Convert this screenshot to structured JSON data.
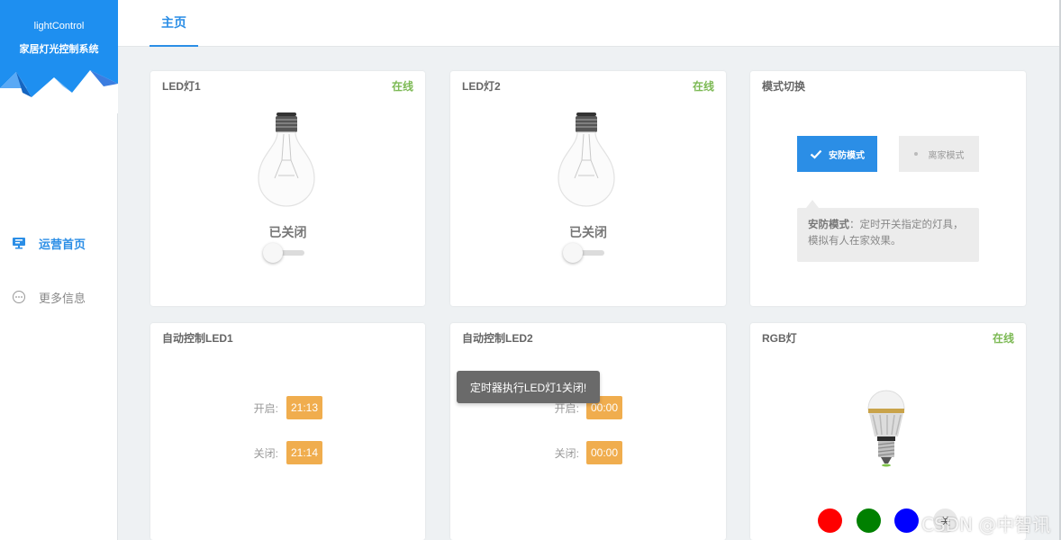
{
  "app": {
    "name": "lightControl",
    "subtitle": "家居灯光控制系统"
  },
  "sidebar": {
    "items": [
      {
        "label": "运营首页",
        "icon": "monitor-icon",
        "active": true
      },
      {
        "label": "更多信息",
        "icon": "more-circle-icon",
        "active": false
      }
    ]
  },
  "tabs": [
    {
      "label": "主页",
      "active": true
    }
  ],
  "cards": {
    "led1": {
      "title": "LED灯1",
      "status": "在线",
      "state": "已关闭",
      "on": false
    },
    "led2": {
      "title": "LED灯2",
      "status": "在线",
      "state": "已关闭",
      "on": false
    },
    "mode": {
      "title": "模式切换",
      "guard_label": "安防模式",
      "away_label": "离家模式",
      "tip_title": "安防模式",
      "tip_sep": "：",
      "tip_text": "定时开关指定的灯具，模拟有人在家效果。"
    },
    "auto1": {
      "title": "自动控制LED1",
      "open_label": "开启:",
      "open_time": "21:13",
      "close_label": "关闭:",
      "close_time": "21:14"
    },
    "auto2": {
      "title": "自动控制LED2",
      "open_label": "开启:",
      "open_time": "00:00",
      "close_label": "关闭:",
      "close_time": "00:00"
    },
    "rgb": {
      "title": "RGB灯",
      "status": "在线",
      "colors": [
        "#ff0000",
        "#008000",
        "#0000ff"
      ],
      "off_label": "关"
    }
  },
  "toast": {
    "text": "定时器执行LED灯1关闭!"
  },
  "watermark": "CSDN @中智讯",
  "colors": {
    "accent": "#2b8ee6",
    "online": "#7cb954",
    "timer": "#f0ad4e"
  }
}
